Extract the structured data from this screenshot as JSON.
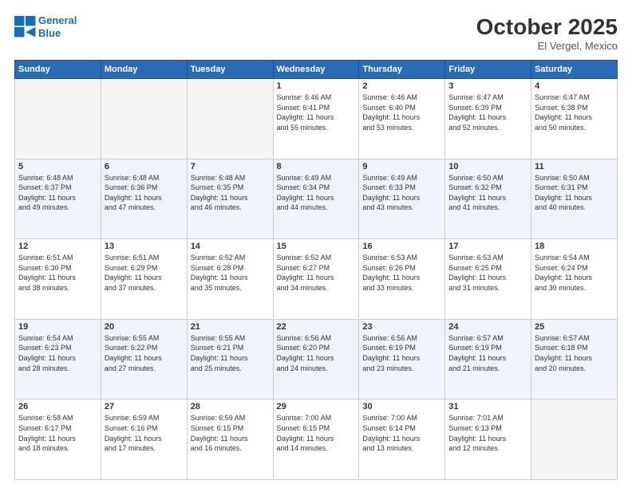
{
  "header": {
    "logo_line1": "General",
    "logo_line2": "Blue",
    "month": "October 2025",
    "location": "El Vergel, Mexico"
  },
  "weekdays": [
    "Sunday",
    "Monday",
    "Tuesday",
    "Wednesday",
    "Thursday",
    "Friday",
    "Saturday"
  ],
  "weeks": [
    [
      {
        "day": "",
        "info": ""
      },
      {
        "day": "",
        "info": ""
      },
      {
        "day": "",
        "info": ""
      },
      {
        "day": "1",
        "info": "Sunrise: 6:46 AM\nSunset: 6:41 PM\nDaylight: 11 hours\nand 55 minutes."
      },
      {
        "day": "2",
        "info": "Sunrise: 6:46 AM\nSunset: 6:40 PM\nDaylight: 11 hours\nand 53 minutes."
      },
      {
        "day": "3",
        "info": "Sunrise: 6:47 AM\nSunset: 6:39 PM\nDaylight: 11 hours\nand 52 minutes."
      },
      {
        "day": "4",
        "info": "Sunrise: 6:47 AM\nSunset: 6:38 PM\nDaylight: 11 hours\nand 50 minutes."
      }
    ],
    [
      {
        "day": "5",
        "info": "Sunrise: 6:48 AM\nSunset: 6:37 PM\nDaylight: 11 hours\nand 49 minutes."
      },
      {
        "day": "6",
        "info": "Sunrise: 6:48 AM\nSunset: 6:36 PM\nDaylight: 11 hours\nand 47 minutes."
      },
      {
        "day": "7",
        "info": "Sunrise: 6:48 AM\nSunset: 6:35 PM\nDaylight: 11 hours\nand 46 minutes."
      },
      {
        "day": "8",
        "info": "Sunrise: 6:49 AM\nSunset: 6:34 PM\nDaylight: 11 hours\nand 44 minutes."
      },
      {
        "day": "9",
        "info": "Sunrise: 6:49 AM\nSunset: 6:33 PM\nDaylight: 11 hours\nand 43 minutes."
      },
      {
        "day": "10",
        "info": "Sunrise: 6:50 AM\nSunset: 6:32 PM\nDaylight: 11 hours\nand 41 minutes."
      },
      {
        "day": "11",
        "info": "Sunrise: 6:50 AM\nSunset: 6:31 PM\nDaylight: 11 hours\nand 40 minutes."
      }
    ],
    [
      {
        "day": "12",
        "info": "Sunrise: 6:51 AM\nSunset: 6:30 PM\nDaylight: 11 hours\nand 38 minutes."
      },
      {
        "day": "13",
        "info": "Sunrise: 6:51 AM\nSunset: 6:29 PM\nDaylight: 11 hours\nand 37 minutes."
      },
      {
        "day": "14",
        "info": "Sunrise: 6:52 AM\nSunset: 6:28 PM\nDaylight: 11 hours\nand 35 minutes."
      },
      {
        "day": "15",
        "info": "Sunrise: 6:52 AM\nSunset: 6:27 PM\nDaylight: 11 hours\nand 34 minutes."
      },
      {
        "day": "16",
        "info": "Sunrise: 6:53 AM\nSunset: 6:26 PM\nDaylight: 11 hours\nand 33 minutes."
      },
      {
        "day": "17",
        "info": "Sunrise: 6:53 AM\nSunset: 6:25 PM\nDaylight: 11 hours\nand 31 minutes."
      },
      {
        "day": "18",
        "info": "Sunrise: 6:54 AM\nSunset: 6:24 PM\nDaylight: 11 hours\nand 30 minutes."
      }
    ],
    [
      {
        "day": "19",
        "info": "Sunrise: 6:54 AM\nSunset: 6:23 PM\nDaylight: 11 hours\nand 28 minutes."
      },
      {
        "day": "20",
        "info": "Sunrise: 6:55 AM\nSunset: 6:22 PM\nDaylight: 11 hours\nand 27 minutes."
      },
      {
        "day": "21",
        "info": "Sunrise: 6:55 AM\nSunset: 6:21 PM\nDaylight: 11 hours\nand 25 minutes."
      },
      {
        "day": "22",
        "info": "Sunrise: 6:56 AM\nSunset: 6:20 PM\nDaylight: 11 hours\nand 24 minutes."
      },
      {
        "day": "23",
        "info": "Sunrise: 6:56 AM\nSunset: 6:19 PM\nDaylight: 11 hours\nand 23 minutes."
      },
      {
        "day": "24",
        "info": "Sunrise: 6:57 AM\nSunset: 6:19 PM\nDaylight: 11 hours\nand 21 minutes."
      },
      {
        "day": "25",
        "info": "Sunrise: 6:57 AM\nSunset: 6:18 PM\nDaylight: 11 hours\nand 20 minutes."
      }
    ],
    [
      {
        "day": "26",
        "info": "Sunrise: 6:58 AM\nSunset: 6:17 PM\nDaylight: 11 hours\nand 18 minutes."
      },
      {
        "day": "27",
        "info": "Sunrise: 6:59 AM\nSunset: 6:16 PM\nDaylight: 11 hours\nand 17 minutes."
      },
      {
        "day": "28",
        "info": "Sunrise: 6:59 AM\nSunset: 6:15 PM\nDaylight: 11 hours\nand 16 minutes."
      },
      {
        "day": "29",
        "info": "Sunrise: 7:00 AM\nSunset: 6:15 PM\nDaylight: 11 hours\nand 14 minutes."
      },
      {
        "day": "30",
        "info": "Sunrise: 7:00 AM\nSunset: 6:14 PM\nDaylight: 11 hours\nand 13 minutes."
      },
      {
        "day": "31",
        "info": "Sunrise: 7:01 AM\nSunset: 6:13 PM\nDaylight: 11 hours\nand 12 minutes."
      },
      {
        "day": "",
        "info": ""
      }
    ]
  ]
}
